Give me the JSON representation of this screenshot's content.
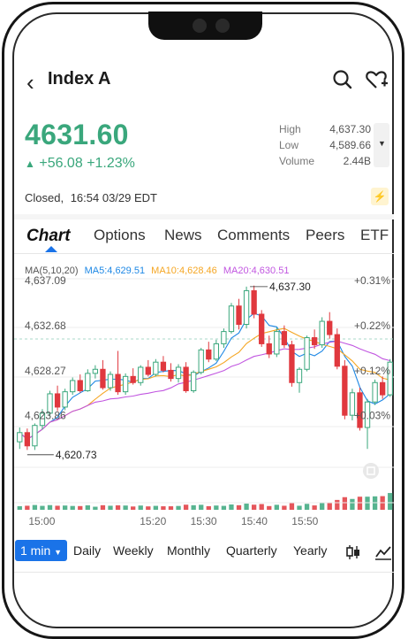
{
  "header": {
    "title": "Index A"
  },
  "quote": {
    "price": "4631.60",
    "change": "+56.08",
    "change_pct": "+1.23%"
  },
  "stats": [
    {
      "label": "High",
      "value": "4,637.30"
    },
    {
      "label": "Low",
      "value": "4,589.66"
    },
    {
      "label": "Volume",
      "value": "2.44B"
    }
  ],
  "status": {
    "state": "Closed,",
    "time": "16:54 03/29 EDT"
  },
  "tabs": [
    "Chart",
    "Options",
    "News",
    "Comments",
    "Peers",
    "ETF"
  ],
  "ma": {
    "label": "MA(5,10,20)",
    "ma5": "MA5:4,629.51",
    "ma10": "MA10:4,628.46",
    "ma20": "MA20:4,630.51"
  },
  "colors": {
    "up": "#3aa77c",
    "down": "#e0383e",
    "ma5": "#1e88e5",
    "ma10": "#f5a623",
    "ma20": "#c156e0",
    "accent": "#1a73e8"
  },
  "periods": [
    "1 min",
    "Daily",
    "Weekly",
    "Monthly",
    "Quarterly",
    "Yearly"
  ],
  "chart_data": {
    "type": "candlestick",
    "y_labels": [
      "4,637.09",
      "4,632.68",
      "4,628.27",
      "4,623.86"
    ],
    "pct_labels": [
      "+0.31%",
      "+0.22%",
      "+0.12%",
      "+0.03%"
    ],
    "x_labels": [
      "15:00",
      "15:20",
      "15:30",
      "15:40",
      "15:50"
    ],
    "ylim": [
      4619.5,
      4638.4
    ],
    "annotations": {
      "high": "4,637.30",
      "low": "4,620.73"
    },
    "candles": [
      [
        4622.0,
        4623.4,
        4621.3,
        4622.9
      ],
      [
        4622.9,
        4623.3,
        4621.2,
        4621.6
      ],
      [
        4621.6,
        4623.8,
        4621.2,
        4623.6
      ],
      [
        4623.6,
        4625.2,
        4623.2,
        4624.8
      ],
      [
        4624.8,
        4627.0,
        4624.5,
        4626.7
      ],
      [
        4626.7,
        4627.5,
        4625.0,
        4625.4
      ],
      [
        4625.4,
        4627.2,
        4625.1,
        4626.9
      ],
      [
        4626.9,
        4628.3,
        4626.6,
        4628.0
      ],
      [
        4628.0,
        4628.6,
        4626.8,
        4627.0
      ],
      [
        4627.0,
        4629.1,
        4626.9,
        4628.7
      ],
      [
        4628.7,
        4629.5,
        4628.2,
        4629.1
      ],
      [
        4629.1,
        4630.0,
        4627.1,
        4627.3
      ],
      [
        4627.3,
        4628.9,
        4627.0,
        4628.6
      ],
      [
        4628.6,
        4630.9,
        4626.6,
        4626.9
      ],
      [
        4626.9,
        4628.7,
        4626.6,
        4628.4
      ],
      [
        4628.4,
        4629.2,
        4627.6,
        4627.8
      ],
      [
        4627.8,
        4629.5,
        4627.5,
        4629.3
      ],
      [
        4629.3,
        4630.0,
        4628.4,
        4628.6
      ],
      [
        4628.6,
        4630.1,
        4628.4,
        4629.8
      ],
      [
        4629.8,
        4630.4,
        4628.8,
        4629.0
      ],
      [
        4629.0,
        4629.7,
        4627.9,
        4628.2
      ],
      [
        4628.2,
        4629.6,
        4627.8,
        4629.3
      ],
      [
        4629.3,
        4629.8,
        4626.8,
        4627.0
      ],
      [
        4627.0,
        4629.0,
        4626.8,
        4628.8
      ],
      [
        4628.8,
        4631.2,
        4628.6,
        4631.0
      ],
      [
        4631.0,
        4631.8,
        4629.8,
        4630.1
      ],
      [
        4630.1,
        4632.0,
        4629.9,
        4631.6
      ],
      [
        4631.6,
        4633.1,
        4631.2,
        4632.8
      ],
      [
        4632.8,
        4635.6,
        4632.6,
        4635.3
      ],
      [
        4635.3,
        4636.0,
        4633.0,
        4633.5
      ],
      [
        4633.5,
        4637.2,
        4633.1,
        4636.8
      ],
      [
        4636.8,
        4637.3,
        4634.1,
        4634.5
      ],
      [
        4634.5,
        4634.9,
        4631.3,
        4631.6
      ],
      [
        4631.6,
        4632.4,
        4630.2,
        4630.6
      ],
      [
        4630.6,
        4633.2,
        4630.3,
        4632.8
      ],
      [
        4632.8,
        4633.4,
        4631.2,
        4631.5
      ],
      [
        4631.5,
        4631.9,
        4627.4,
        4627.8
      ],
      [
        4627.8,
        4629.3,
        4626.8,
        4629.1
      ],
      [
        4629.1,
        4632.4,
        4628.9,
        4632.2
      ],
      [
        4632.2,
        4633.0,
        4631.1,
        4631.5
      ],
      [
        4631.5,
        4634.2,
        4631.2,
        4633.8
      ],
      [
        4633.8,
        4634.7,
        4632.1,
        4632.5
      ],
      [
        4632.5,
        4633.1,
        4629.1,
        4629.4
      ],
      [
        4629.4,
        4630.0,
        4624.2,
        4624.6
      ],
      [
        4624.6,
        4627.2,
        4624.1,
        4626.8
      ],
      [
        4626.8,
        4627.3,
        4623.1,
        4623.4
      ],
      [
        4623.4,
        4626.2,
        4621.3,
        4625.9
      ],
      [
        4625.9,
        4628.1,
        4625.6,
        4627.8
      ],
      [
        4627.8,
        4628.4,
        4626.2,
        4626.6
      ],
      [
        4626.6,
        4630.1,
        4626.4,
        4629.8
      ]
    ]
  }
}
